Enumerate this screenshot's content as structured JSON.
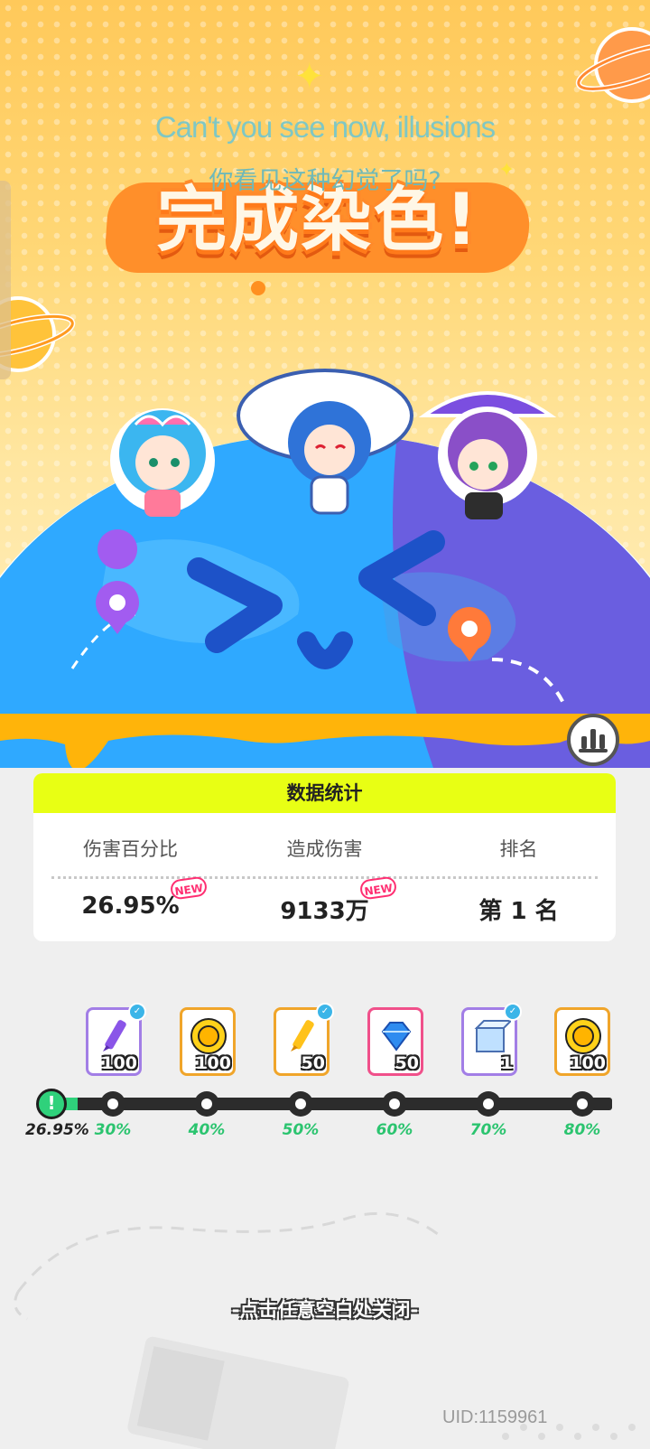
{
  "hero": {
    "caption_en": "Can't you see now, illusions",
    "caption_zh": "你看见这种幻觉了吗?",
    "banner_title": "完成染色!"
  },
  "stats": {
    "header": "数据统计",
    "columns": [
      {
        "label": "伤害百分比",
        "value": "26.95%",
        "new": true
      },
      {
        "label": "造成伤害",
        "value": "9133万",
        "new": true
      },
      {
        "label": "排名",
        "value": "第 1 名",
        "new": false
      }
    ],
    "new_badge": "NEW"
  },
  "rewards": {
    "items": [
      {
        "icon": "purple-crayon-icon",
        "count": "100",
        "border": "#a27ee6"
      },
      {
        "icon": "gold-coin-icon",
        "count": "100",
        "border": "#f0a52a"
      },
      {
        "icon": "yellow-crayon-icon",
        "count": "50",
        "border": "#f0a52a"
      },
      {
        "icon": "blue-diamond-icon",
        "count": "50",
        "border": "#f0508a"
      },
      {
        "icon": "mystery-box-icon",
        "count": "1",
        "border": "#a27ee6"
      },
      {
        "icon": "gold-coin-icon",
        "count": "100",
        "border": "#f0a52a"
      }
    ],
    "milestones": [
      "30%",
      "40%",
      "50%",
      "60%",
      "70%",
      "80%"
    ],
    "current_progress": "26.95%"
  },
  "close_hint": "-点击任意空白处关闭-",
  "uid": "UID:1159961",
  "colors": {
    "accent_lime": "#e8ff14",
    "progress_green": "#2fd17b",
    "new_pink": "#ff2f72"
  }
}
